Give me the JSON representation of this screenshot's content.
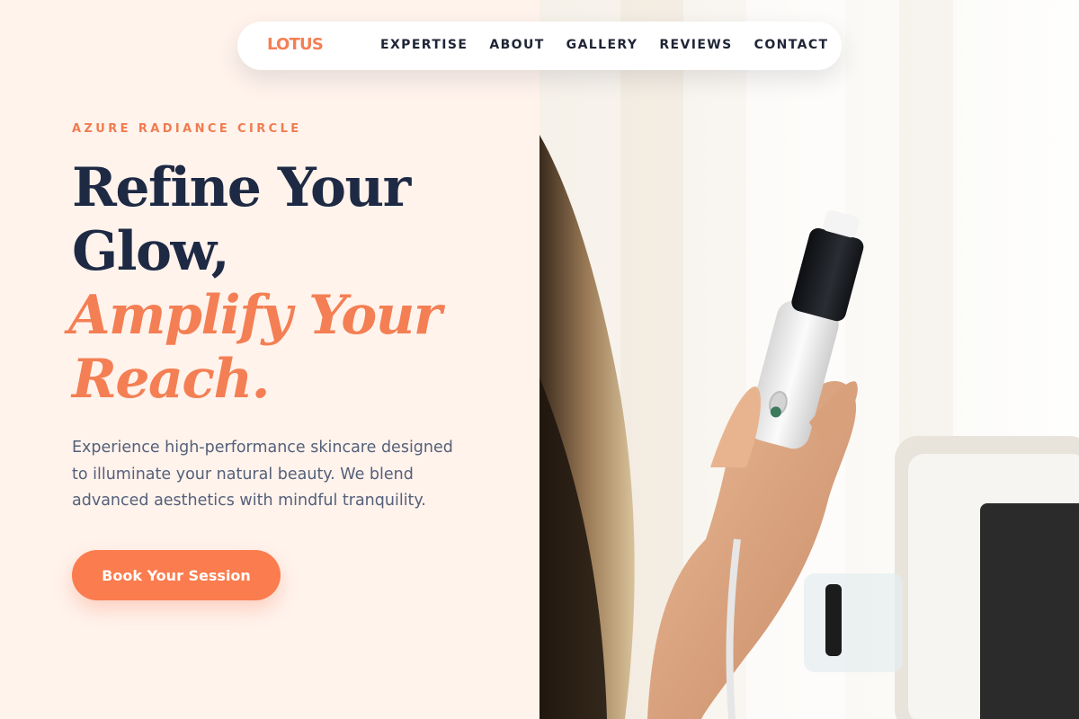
{
  "nav": {
    "logo": "LOTUS",
    "links": [
      "EXPERTISE",
      "ABOUT",
      "GALLERY",
      "REVIEWS",
      "CONTACT"
    ]
  },
  "hero": {
    "eyebrow": "AZURE RADIANCE CIRCLE",
    "headline": {
      "line1": "Refine Your",
      "line2": "Glow,",
      "accent_line1": "Amplify Your",
      "accent_line2": "Reach."
    },
    "description_lines": [
      "Experience high-performance skincare designed",
      "to illuminate your natural beauty. We blend",
      "advanced aesthetics with mindful tranquility."
    ],
    "cta_label": "Book Your Session"
  },
  "colors": {
    "accent": "#f47f54",
    "cta": "#fb7c4e",
    "heading": "#1e2a44",
    "body_text": "#55607a",
    "background": "#fff3ec"
  },
  "photo": {
    "subject": "hand-holding-skincare-device"
  }
}
